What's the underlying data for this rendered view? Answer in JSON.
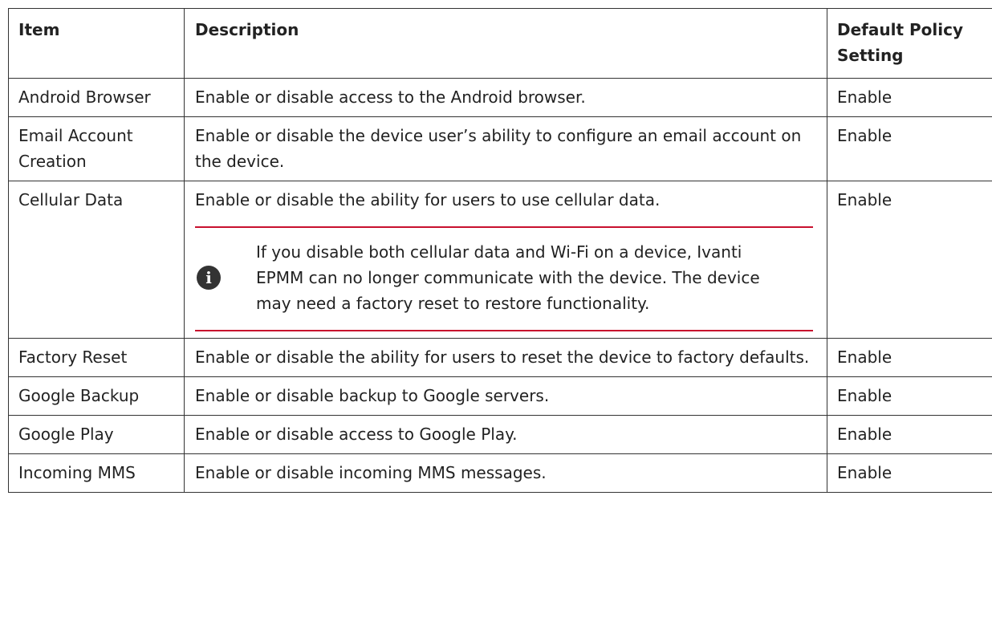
{
  "table": {
    "headers": {
      "item": "Item",
      "description": "Description",
      "default": "Default Policy Setting"
    },
    "rows": [
      {
        "item": "Android Browser",
        "description": "Enable or disable access to the Android browser.",
        "default": "Enable"
      },
      {
        "item": "Email Account Creation",
        "description": "Enable or disable the device user’s ability to configure an email account on the device.",
        "default": "Enable"
      },
      {
        "item": "Cellular Data",
        "description": "Enable or disable the ability for users to use cellular data.",
        "note": "If you disable both cellular data and Wi-Fi on a device, Ivanti EPMM can no longer communicate with the device. The device may need a factory reset to restore functionality.",
        "default": "Enable"
      },
      {
        "item": "Factory Reset",
        "description": "Enable or disable the ability for users to reset the device to factory defaults.",
        "default": "Enable"
      },
      {
        "item": "Google Backup",
        "description": "Enable or disable backup to Google servers.",
        "default": "Enable"
      },
      {
        "item": "Google Play",
        "description": "Enable or disable access to Google Play.",
        "default": "Enable"
      },
      {
        "item": "Incoming MMS",
        "description": "Enable or disable incoming MMS messages.",
        "default": "Enable"
      }
    ],
    "note_icon": "info-icon",
    "note_accent_color": "#c8102e"
  }
}
